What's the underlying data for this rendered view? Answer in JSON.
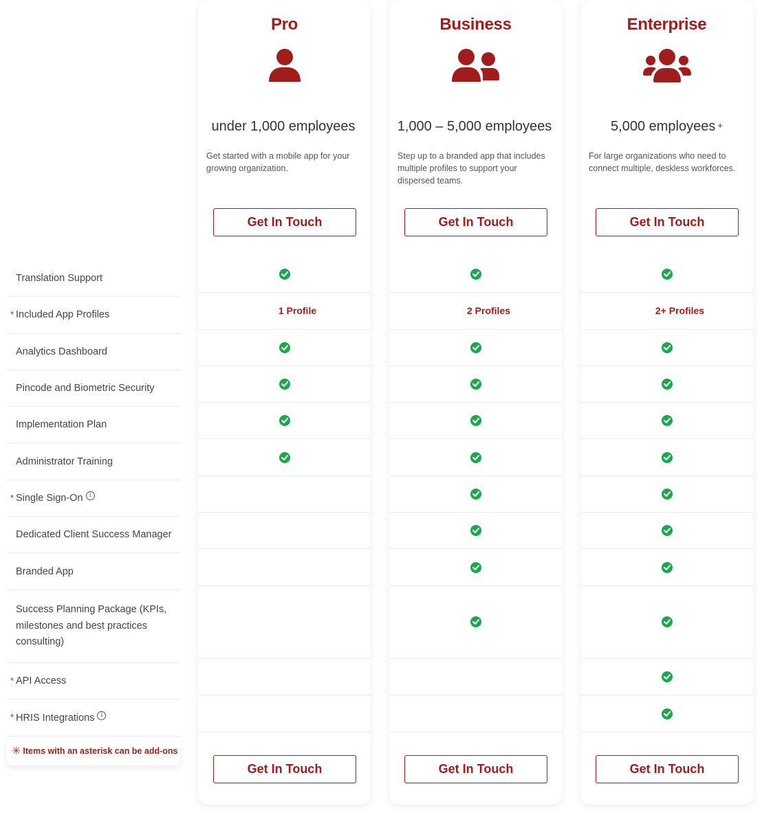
{
  "colors": {
    "brand": "#a11d1d",
    "check": "#1aa84f",
    "text": "#444444"
  },
  "features": [
    {
      "label": "Translation Support",
      "asterisk": false,
      "info": false
    },
    {
      "label": "Included App Profiles",
      "asterisk": true,
      "info": false
    },
    {
      "label": "Analytics Dashboard",
      "asterisk": false,
      "info": false
    },
    {
      "label": "Pincode and Biometric Security",
      "asterisk": false,
      "info": false
    },
    {
      "label": "Implementation Plan",
      "asterisk": false,
      "info": false
    },
    {
      "label": "Administrator Training",
      "asterisk": false,
      "info": false
    },
    {
      "label": "Single Sign-On",
      "asterisk": true,
      "info": true
    },
    {
      "label": "Dedicated Client Success Manager",
      "asterisk": false,
      "info": false
    },
    {
      "label": "Branded App",
      "asterisk": false,
      "info": false
    },
    {
      "label": "Success Planning Package (KPIs, milestones and best practices consulting)",
      "asterisk": false,
      "info": false
    },
    {
      "label": "API Access",
      "asterisk": true,
      "info": false
    },
    {
      "label": "HRIS Integrations",
      "asterisk": true,
      "info": true
    }
  ],
  "asterisk_symbol": "*",
  "info_symbol": "i",
  "addon_note": {
    "star": "✳",
    "text": "Items with an asterisk can be add-ons"
  },
  "plans": [
    {
      "name": "Pro",
      "icon": "user-icon",
      "employees": "under 1,000 employees",
      "employees_suffix": "",
      "description": "Get started with a mobile app for your growing organization.",
      "cta_top": "Get In Touch",
      "cta_bottom": "Get In Touch",
      "cells": [
        "check",
        "1 Profile",
        "check",
        "check",
        "check",
        "check",
        "",
        "",
        "",
        "",
        "",
        ""
      ]
    },
    {
      "name": "Business",
      "icon": "user-pair-icon",
      "employees": "1,000 – 5,000 employees",
      "employees_suffix": "",
      "description": "Step up to a branded app that includes multiple profiles to support your dispersed teams.",
      "cta_top": "Get In Touch",
      "cta_bottom": "Get In Touch",
      "cells": [
        "check",
        "2 Profiles",
        "check",
        "check",
        "check",
        "check",
        "check",
        "check",
        "check",
        "check",
        "",
        ""
      ]
    },
    {
      "name": "Enterprise",
      "icon": "users-group-icon",
      "employees": "5,000 employees",
      "employees_suffix": "+",
      "description": "For large organizations who need to connect multiple, deskless workforces.",
      "cta_top": "Get In Touch",
      "cta_bottom": "Get In Touch",
      "cells": [
        "check",
        "2+ Profiles",
        "check",
        "check",
        "check",
        "check",
        "check",
        "check",
        "check",
        "check",
        "check",
        "check"
      ]
    }
  ]
}
